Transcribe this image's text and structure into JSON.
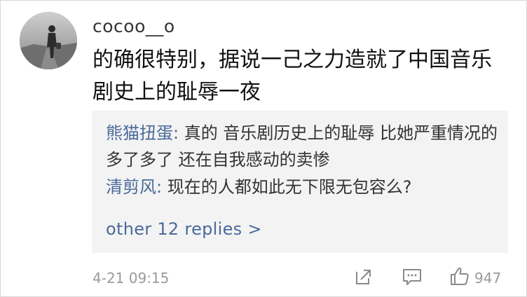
{
  "comment": {
    "username": "cocoo__o",
    "text": "的确很特别，据说一己之力造就了中国音乐剧史上的耻辱一夜",
    "timestamp": "4-21 09:15",
    "like_count": "947"
  },
  "replies": [
    {
      "user": "熊猫扭蛋",
      "separator": ": ",
      "text": "真的 音乐剧历史上的耻辱 比她严重情况的多了多了 还在自我感动的卖惨"
    },
    {
      "user": "清剪风",
      "separator": ": ",
      "text": "现在的人都如此无下限无包容么?"
    }
  ],
  "more_replies_label": "other 12 replies >",
  "icons": {
    "share": "share-icon",
    "comment": "comment-icon",
    "like": "thumbs-up-icon"
  },
  "colors": {
    "link": "#4a6a9a",
    "reply_background": "#f3f3f3",
    "meta": "#9a9a9a"
  }
}
